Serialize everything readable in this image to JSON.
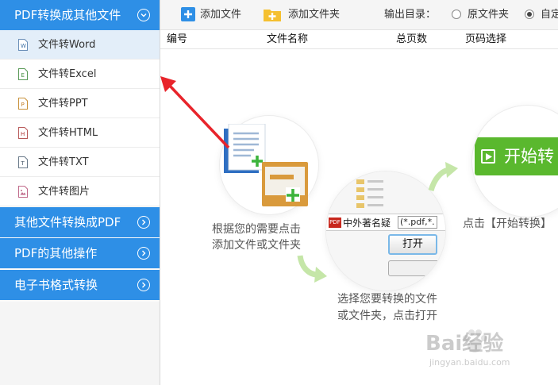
{
  "sidebar": {
    "sections": [
      {
        "label": "PDF转换成其他文件"
      },
      {
        "label": "其他文件转换成PDF"
      },
      {
        "label": "PDF的其他操作"
      },
      {
        "label": "电子书格式转换"
      }
    ],
    "items": [
      {
        "label": "文件转Word",
        "icon_letter": "W"
      },
      {
        "label": "文件转Excel",
        "icon_letter": "E"
      },
      {
        "label": "文件转PPT",
        "icon_letter": "P"
      },
      {
        "label": "文件转HTML",
        "icon_letter": "H"
      },
      {
        "label": "文件转TXT",
        "icon_letter": "T"
      },
      {
        "label": "文件转图片",
        "icon_letter": ""
      }
    ]
  },
  "toolbar": {
    "add_file_label": "添加文件",
    "add_folder_label": "添加文件夹",
    "output_dir_label": "输出目录：",
    "radio_original_label": "原文件夹",
    "radio_custom_label": "自定"
  },
  "table": {
    "headers": [
      "编号",
      "文件名称",
      "总页数",
      "页码选择"
    ]
  },
  "illustration": {
    "step1_caption": [
      "根据您的需要点击",
      "添加文件或文件夹"
    ],
    "step2_caption": [
      "选择您要转换的文件",
      "或文件夹，点击打开"
    ],
    "step2_file_text": "中外著名疑",
    "step2_filter_text": "(*.pdf,*.",
    "step2_open_button": "打开",
    "step2_pdf_badge": "PDF",
    "step3_button_text": "开始转",
    "step3_caption": "点击【开始转换】"
  },
  "watermark": {
    "brand": "Bai经验",
    "url": "jingyan.baidu.com"
  },
  "colors": {
    "accent": "#2e8fe6",
    "green_button": "#5ab82e",
    "arrow_red": "#e8242b",
    "arrow_green": "#c5e6a8"
  }
}
